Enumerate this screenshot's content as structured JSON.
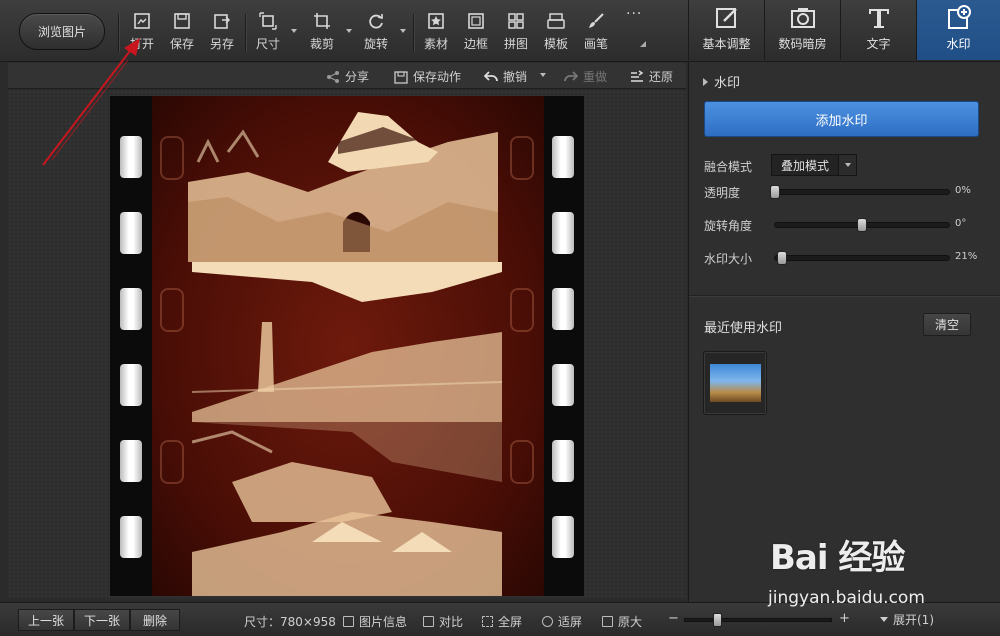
{
  "toolbar": {
    "browse_label": "浏览图片",
    "tools": [
      {
        "label": "打开",
        "icon": "open-icon"
      },
      {
        "label": "保存",
        "icon": "save-icon"
      },
      {
        "label": "另存",
        "icon": "save-as-icon"
      },
      {
        "label": "尺寸",
        "icon": "resize-icon"
      },
      {
        "label": "裁剪",
        "icon": "crop-icon"
      },
      {
        "label": "旋转",
        "icon": "rotate-icon"
      },
      {
        "label": "素材",
        "icon": "material-icon"
      },
      {
        "label": "边框",
        "icon": "border-icon"
      },
      {
        "label": "拼图",
        "icon": "collage-icon"
      },
      {
        "label": "模板",
        "icon": "template-icon"
      },
      {
        "label": "画笔",
        "icon": "brush-icon"
      },
      {
        "label": "···",
        "icon": "more-icon"
      }
    ]
  },
  "tabs": [
    {
      "label": "基本调整",
      "icon": "adjust-icon"
    },
    {
      "label": "数码暗房",
      "icon": "camera-icon"
    },
    {
      "label": "文字",
      "icon": "text-icon"
    },
    {
      "label": "水印",
      "icon": "watermark-icon",
      "active": true
    }
  ],
  "actions": {
    "share": "分享",
    "save_action": "保存动作",
    "undo": "撤销",
    "redo": "重做",
    "restore": "还原"
  },
  "panel": {
    "title": "水印",
    "add_button": "添加水印",
    "blend_label": "融合模式",
    "blend_value": "叠加模式",
    "opacity_label": "透明度",
    "opacity_value": "0%",
    "opacity_fraction": 0,
    "rotation_label": "旋转角度",
    "rotation_value": "0°",
    "rotation_fraction": 0.5,
    "size_label": "水印大小",
    "size_value": "21%",
    "size_fraction": 0.04,
    "recent_title": "最近使用水印",
    "clear_button": "清空"
  },
  "status": {
    "prev": "上一张",
    "next": "下一张",
    "delete": "删除",
    "size_text": "尺寸：780×958",
    "info": "图片信息",
    "compare": "对比",
    "fullscreen": "全屏",
    "fit": "适屏",
    "original": "原大",
    "zoom_minus": "−",
    "zoom_plus": "+",
    "zoom_fraction": 0.22,
    "expand": "展开(1)"
  },
  "watermark": {
    "brand": "Bai 经验",
    "url": "jingyan.baidu.com"
  },
  "colors": {
    "accent": "#2e6fc4",
    "film_red": "#6e1a0c",
    "sepia": "#e8c39a"
  }
}
